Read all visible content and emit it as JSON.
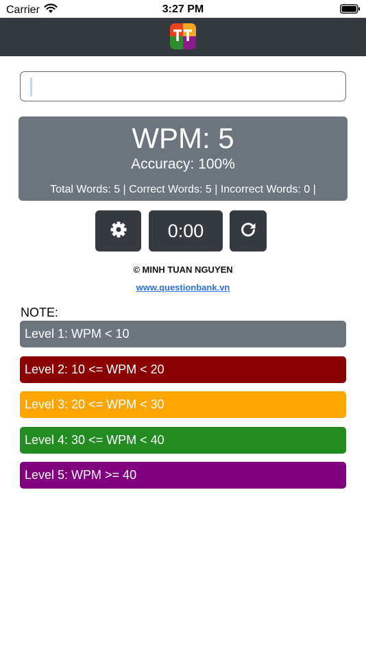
{
  "status_bar": {
    "carrier": "Carrier",
    "time": "3:27 PM"
  },
  "input": {
    "value": "",
    "placeholder": ""
  },
  "stats": {
    "wpm": "WPM: 5",
    "accuracy": "Accuracy: 100%",
    "counts": "Total Words: 5 | Correct Words: 5 | Incorrect Words: 0 |"
  },
  "controls": {
    "settings_icon": "gear-icon",
    "timer": "0:00",
    "reset_icon": "refresh-icon"
  },
  "footer": {
    "copyright": "© MINH TUAN NGUYEN",
    "website": "www.questionbank.vn"
  },
  "note_label": "NOTE:",
  "levels": [
    {
      "label": "Level 1: WPM < 10",
      "color": "#6c757d"
    },
    {
      "label": "Level 2: 10 <= WPM < 20",
      "color": "#8b0000"
    },
    {
      "label": "Level 3: 20 <= WPM < 30",
      "color": "#ffa500"
    },
    {
      "label": "Level 4: 30 <= WPM < 40",
      "color": "#228b22"
    },
    {
      "label": "Level 5: WPM >= 40",
      "color": "#800080"
    }
  ],
  "colors": {
    "nav_bar": "#343a40",
    "stats_panel": "#6c757d",
    "link": "#2f6fd6"
  }
}
